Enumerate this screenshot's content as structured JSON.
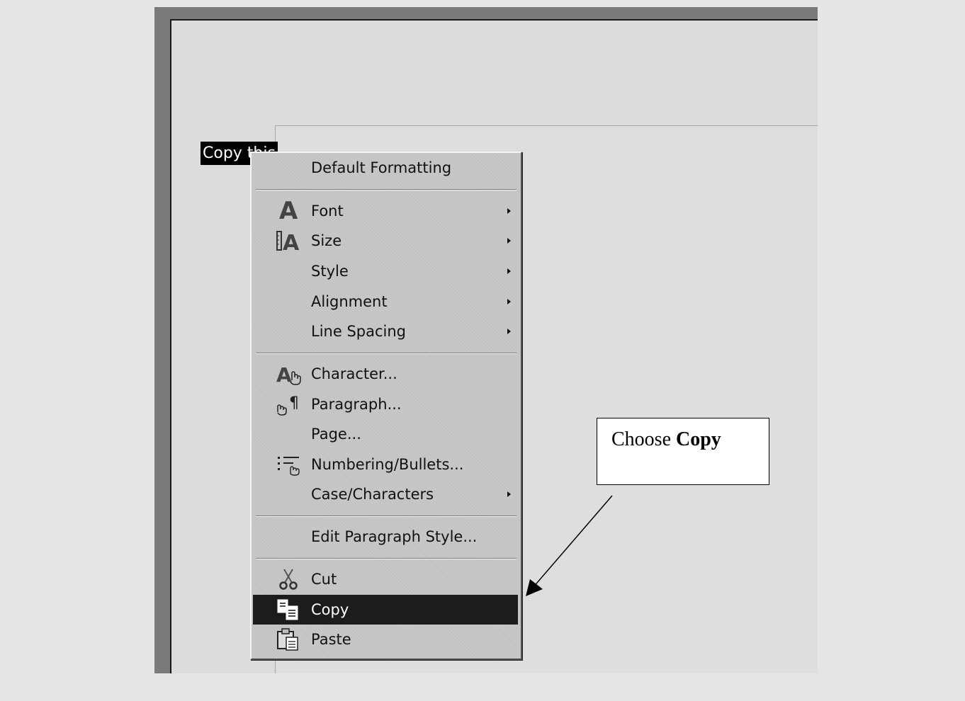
{
  "document": {
    "selected_text": "Copy this"
  },
  "context_menu": {
    "items": [
      {
        "label": "Default Formatting",
        "icon": "",
        "submenu": false
      },
      {
        "label": "Font",
        "icon": "font-icon",
        "submenu": true
      },
      {
        "label": "Size",
        "icon": "size-icon",
        "submenu": true
      },
      {
        "label": "Style",
        "icon": "",
        "submenu": true
      },
      {
        "label": "Alignment",
        "icon": "",
        "submenu": true
      },
      {
        "label": "Line Spacing",
        "icon": "",
        "submenu": true
      },
      {
        "label": "Character...",
        "icon": "character-icon",
        "submenu": false
      },
      {
        "label": "Paragraph...",
        "icon": "paragraph-icon",
        "submenu": false
      },
      {
        "label": "Page...",
        "icon": "",
        "submenu": false
      },
      {
        "label": "Numbering/Bullets...",
        "icon": "numbering-icon",
        "submenu": false
      },
      {
        "label": "Case/Characters",
        "icon": "",
        "submenu": true
      },
      {
        "label": "Edit Paragraph Style...",
        "icon": "",
        "submenu": false
      },
      {
        "label": "Cut",
        "icon": "scissors-icon",
        "submenu": false
      },
      {
        "label": "Copy",
        "icon": "copy-icon",
        "submenu": false,
        "highlighted": true
      },
      {
        "label": "Paste",
        "icon": "paste-icon",
        "submenu": false
      }
    ]
  },
  "callout": {
    "prefix": "Choose ",
    "emphasis": "Copy"
  },
  "colors": {
    "highlight": "#1c1c1c",
    "menu_background": "#c8c8c8",
    "frame": "#7a7a7a"
  }
}
